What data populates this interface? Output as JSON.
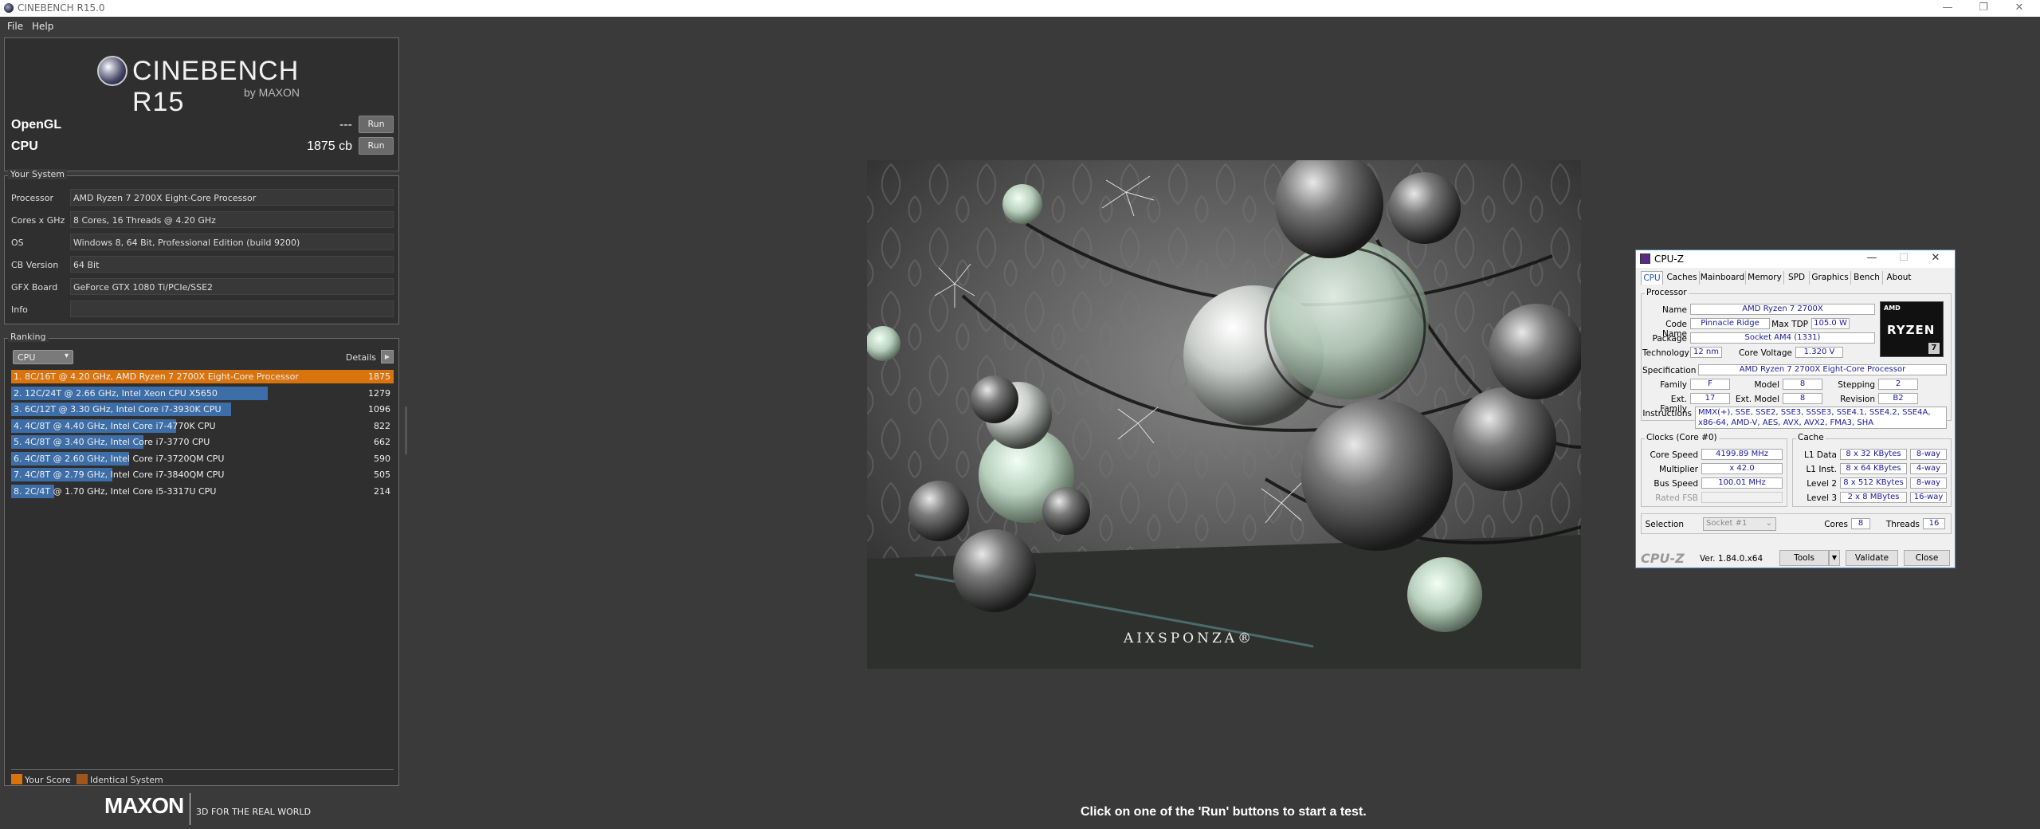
{
  "window": {
    "title": "CINEBENCH R15.0"
  },
  "menu": [
    "File",
    "Help"
  ],
  "logo": {
    "title": "CINEBENCH R15",
    "subtitle": "by MAXON"
  },
  "bench": [
    {
      "label": "OpenGL",
      "score": "---",
      "button": "Run"
    },
    {
      "label": "CPU",
      "score": "1875 cb",
      "button": "Run"
    }
  ],
  "system": {
    "title": "Your System",
    "rows": [
      {
        "k": "Processor",
        "v": "AMD Ryzen 7 2700X Eight-Core Processor"
      },
      {
        "k": "Cores x GHz",
        "v": "8 Cores, 16 Threads @ 4.20 GHz"
      },
      {
        "k": "OS",
        "v": "Windows 8, 64 Bit, Professional Edition (build 9200)"
      },
      {
        "k": "CB Version",
        "v": "64 Bit"
      },
      {
        "k": "GFX Board",
        "v": "GeForce GTX 1080 Ti/PCIe/SSE2"
      },
      {
        "k": "Info",
        "v": ""
      }
    ]
  },
  "ranking": {
    "title": "Ranking",
    "dropdown": "CPU",
    "details": "Details",
    "max": 1875,
    "rows": [
      {
        "text": "1. 8C/16T @ 4.20 GHz, AMD Ryzen 7 2700X Eight-Core Processor",
        "score": 1875,
        "mine": true
      },
      {
        "text": "2. 12C/24T @ 2.66 GHz, Intel Xeon CPU X5650",
        "score": 1279,
        "mine": false
      },
      {
        "text": "3. 6C/12T @ 3.30 GHz,  Intel Core i7-3930K CPU",
        "score": 1096,
        "mine": false
      },
      {
        "text": "4. 4C/8T @ 4.40 GHz, Intel Core i7-4770K CPU",
        "score": 822,
        "mine": false
      },
      {
        "text": "5. 4C/8T @ 3.40 GHz,  Intel Core i7-3770 CPU",
        "score": 662,
        "mine": false
      },
      {
        "text": "6. 4C/8T @ 2.60 GHz, Intel Core i7-3720QM CPU",
        "score": 590,
        "mine": false
      },
      {
        "text": "7. 4C/8T @ 2.79 GHz,  Intel Core i7-3840QM CPU",
        "score": 505,
        "mine": false
      },
      {
        "text": "8. 2C/4T @ 1.70 GHz,  Intel Core i5-3317U CPU",
        "score": 214,
        "mine": false
      }
    ],
    "legend": [
      {
        "label": "Your Score",
        "color": "#d9730d"
      },
      {
        "label": "Identical System",
        "color": "#a0561a"
      }
    ]
  },
  "footer": {
    "brand": "MAXON",
    "tagline": "3D FOR THE REAL WORLD",
    "hint": "Click on one of the 'Run' buttons to start a test."
  },
  "render": {
    "watermark": "AIXSPONZA®"
  },
  "cpuz": {
    "title": "CPU-Z",
    "tabs": [
      "CPU",
      "Caches",
      "Mainboard",
      "Memory",
      "SPD",
      "Graphics",
      "Bench",
      "About"
    ],
    "processor": {
      "group": "Processor",
      "name_label": "Name",
      "name": "AMD Ryzen 7 2700X",
      "codename_label": "Code Name",
      "codename": "Pinnacle Ridge",
      "tdp_label": "Max TDP",
      "tdp": "105.0 W",
      "package_label": "Package",
      "package": "Socket AM4 (1331)",
      "tech_label": "Technology",
      "tech": "12 nm",
      "voltage_label": "Core Voltage",
      "voltage": "1.320 V",
      "spec_label": "Specification",
      "spec": "AMD Ryzen 7 2700X Eight-Core Processor",
      "family_label": "Family",
      "family": "F",
      "model_label": "Model",
      "model": "8",
      "stepping_label": "Stepping",
      "stepping": "2",
      "extfamily_label": "Ext. Family",
      "extfamily": "17",
      "extmodel_label": "Ext. Model",
      "extmodel": "8",
      "revision_label": "Revision",
      "revision": "B2",
      "instr_label": "Instructions",
      "instr1": "MMX(+), SSE, SSE2, SSE3, SSSE3, SSE4.1, SSE4.2, SSE4A,",
      "instr2": "x86-64, AMD-V, AES, AVX, AVX2, FMA3, SHA"
    },
    "badge": {
      "amd": "AMD",
      "ryzen": "RYZEN",
      "tier": "7"
    },
    "clocks": {
      "group": "Clocks (Core #0)",
      "speed_label": "Core Speed",
      "speed": "4199.89 MHz",
      "mult_label": "Multiplier",
      "mult": "x 42.0",
      "bus_label": "Bus Speed",
      "bus": "100.01 MHz",
      "fsb_label": "Rated FSB",
      "fsb": ""
    },
    "cache": {
      "group": "Cache",
      "rows": [
        {
          "k": "L1 Data",
          "v": "8 x 32 KBytes",
          "w": "8-way"
        },
        {
          "k": "L1 Inst.",
          "v": "8 x 64 KBytes",
          "w": "4-way"
        },
        {
          "k": "Level 2",
          "v": "8 x 512 KBytes",
          "w": "8-way"
        },
        {
          "k": "Level 3",
          "v": "2 x 8 MBytes",
          "w": "16-way"
        }
      ]
    },
    "selection_label": "Selection",
    "selection": "Socket #1",
    "cores_label": "Cores",
    "cores": "8",
    "threads_label": "Threads",
    "threads": "16",
    "brand": "CPU-Z",
    "version": "Ver. 1.84.0.x64",
    "buttons": {
      "tools": "Tools",
      "validate": "Validate",
      "close": "Close"
    }
  }
}
